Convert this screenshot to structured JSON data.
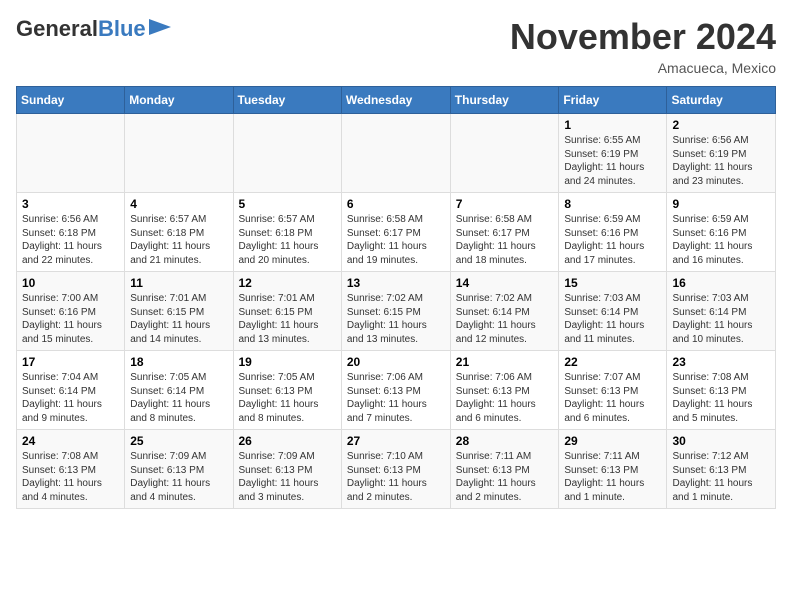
{
  "header": {
    "logo_general": "General",
    "logo_blue": "Blue",
    "month_title": "November 2024",
    "location": "Amacueca, Mexico"
  },
  "calendar": {
    "weekdays": [
      "Sunday",
      "Monday",
      "Tuesday",
      "Wednesday",
      "Thursday",
      "Friday",
      "Saturday"
    ],
    "weeks": [
      [
        {
          "day": "",
          "info": ""
        },
        {
          "day": "",
          "info": ""
        },
        {
          "day": "",
          "info": ""
        },
        {
          "day": "",
          "info": ""
        },
        {
          "day": "",
          "info": ""
        },
        {
          "day": "1",
          "info": "Sunrise: 6:55 AM\nSunset: 6:19 PM\nDaylight: 11 hours and 24 minutes."
        },
        {
          "day": "2",
          "info": "Sunrise: 6:56 AM\nSunset: 6:19 PM\nDaylight: 11 hours and 23 minutes."
        }
      ],
      [
        {
          "day": "3",
          "info": "Sunrise: 6:56 AM\nSunset: 6:18 PM\nDaylight: 11 hours and 22 minutes."
        },
        {
          "day": "4",
          "info": "Sunrise: 6:57 AM\nSunset: 6:18 PM\nDaylight: 11 hours and 21 minutes."
        },
        {
          "day": "5",
          "info": "Sunrise: 6:57 AM\nSunset: 6:18 PM\nDaylight: 11 hours and 20 minutes."
        },
        {
          "day": "6",
          "info": "Sunrise: 6:58 AM\nSunset: 6:17 PM\nDaylight: 11 hours and 19 minutes."
        },
        {
          "day": "7",
          "info": "Sunrise: 6:58 AM\nSunset: 6:17 PM\nDaylight: 11 hours and 18 minutes."
        },
        {
          "day": "8",
          "info": "Sunrise: 6:59 AM\nSunset: 6:16 PM\nDaylight: 11 hours and 17 minutes."
        },
        {
          "day": "9",
          "info": "Sunrise: 6:59 AM\nSunset: 6:16 PM\nDaylight: 11 hours and 16 minutes."
        }
      ],
      [
        {
          "day": "10",
          "info": "Sunrise: 7:00 AM\nSunset: 6:16 PM\nDaylight: 11 hours and 15 minutes."
        },
        {
          "day": "11",
          "info": "Sunrise: 7:01 AM\nSunset: 6:15 PM\nDaylight: 11 hours and 14 minutes."
        },
        {
          "day": "12",
          "info": "Sunrise: 7:01 AM\nSunset: 6:15 PM\nDaylight: 11 hours and 13 minutes."
        },
        {
          "day": "13",
          "info": "Sunrise: 7:02 AM\nSunset: 6:15 PM\nDaylight: 11 hours and 13 minutes."
        },
        {
          "day": "14",
          "info": "Sunrise: 7:02 AM\nSunset: 6:14 PM\nDaylight: 11 hours and 12 minutes."
        },
        {
          "day": "15",
          "info": "Sunrise: 7:03 AM\nSunset: 6:14 PM\nDaylight: 11 hours and 11 minutes."
        },
        {
          "day": "16",
          "info": "Sunrise: 7:03 AM\nSunset: 6:14 PM\nDaylight: 11 hours and 10 minutes."
        }
      ],
      [
        {
          "day": "17",
          "info": "Sunrise: 7:04 AM\nSunset: 6:14 PM\nDaylight: 11 hours and 9 minutes."
        },
        {
          "day": "18",
          "info": "Sunrise: 7:05 AM\nSunset: 6:14 PM\nDaylight: 11 hours and 8 minutes."
        },
        {
          "day": "19",
          "info": "Sunrise: 7:05 AM\nSunset: 6:13 PM\nDaylight: 11 hours and 8 minutes."
        },
        {
          "day": "20",
          "info": "Sunrise: 7:06 AM\nSunset: 6:13 PM\nDaylight: 11 hours and 7 minutes."
        },
        {
          "day": "21",
          "info": "Sunrise: 7:06 AM\nSunset: 6:13 PM\nDaylight: 11 hours and 6 minutes."
        },
        {
          "day": "22",
          "info": "Sunrise: 7:07 AM\nSunset: 6:13 PM\nDaylight: 11 hours and 6 minutes."
        },
        {
          "day": "23",
          "info": "Sunrise: 7:08 AM\nSunset: 6:13 PM\nDaylight: 11 hours and 5 minutes."
        }
      ],
      [
        {
          "day": "24",
          "info": "Sunrise: 7:08 AM\nSunset: 6:13 PM\nDaylight: 11 hours and 4 minutes."
        },
        {
          "day": "25",
          "info": "Sunrise: 7:09 AM\nSunset: 6:13 PM\nDaylight: 11 hours and 4 minutes."
        },
        {
          "day": "26",
          "info": "Sunrise: 7:09 AM\nSunset: 6:13 PM\nDaylight: 11 hours and 3 minutes."
        },
        {
          "day": "27",
          "info": "Sunrise: 7:10 AM\nSunset: 6:13 PM\nDaylight: 11 hours and 2 minutes."
        },
        {
          "day": "28",
          "info": "Sunrise: 7:11 AM\nSunset: 6:13 PM\nDaylight: 11 hours and 2 minutes."
        },
        {
          "day": "29",
          "info": "Sunrise: 7:11 AM\nSunset: 6:13 PM\nDaylight: 11 hours and 1 minute."
        },
        {
          "day": "30",
          "info": "Sunrise: 7:12 AM\nSunset: 6:13 PM\nDaylight: 11 hours and 1 minute."
        }
      ]
    ]
  }
}
